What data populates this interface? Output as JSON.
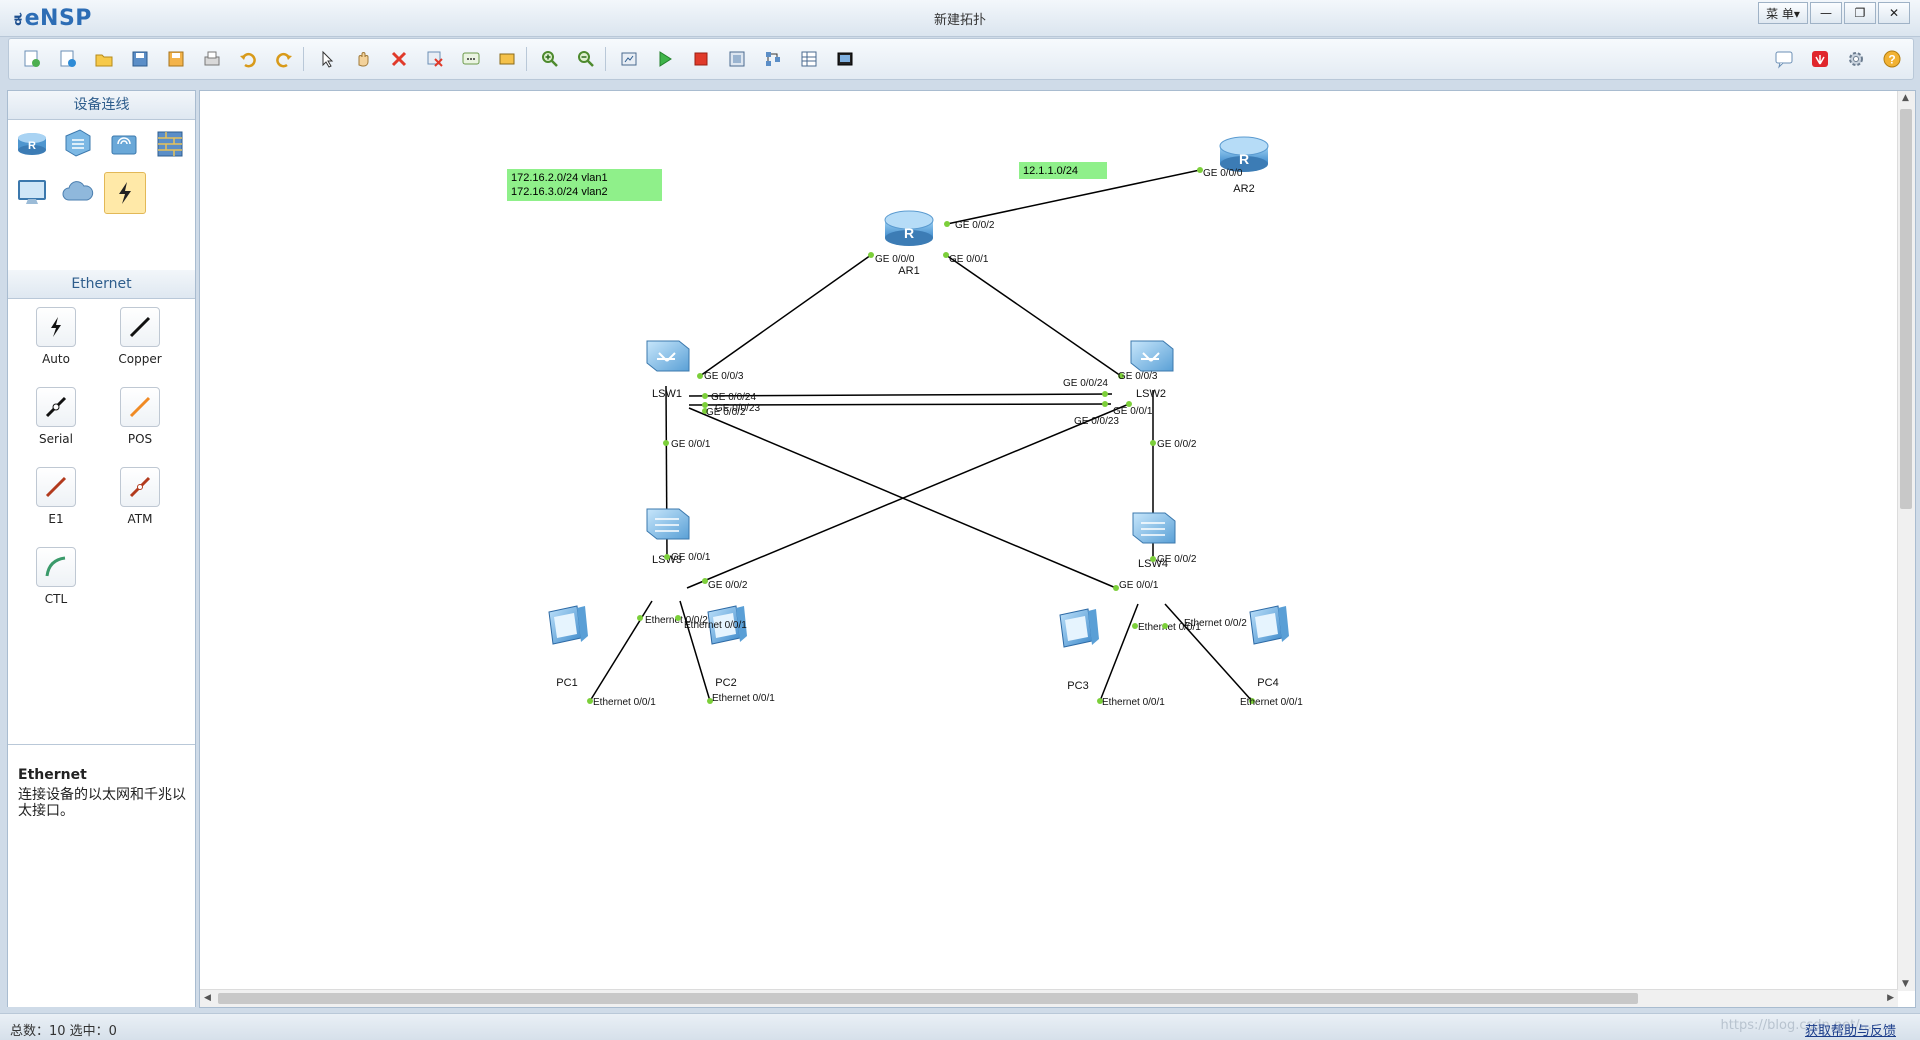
{
  "app": {
    "name": "eNSP",
    "window_title": "新建拓扑"
  },
  "window_buttons": {
    "menu": "菜 单▾",
    "minimize": "—",
    "restore": "❐",
    "close": "✕"
  },
  "toolbar": {
    "items": [
      "new-topology",
      "new-example",
      "open",
      "save",
      "save-as",
      "print",
      "undo",
      "redo",
      "select",
      "pan",
      "delete",
      "delete-all-links",
      "add-text",
      "add-rectangle",
      "zoom-in",
      "zoom-out",
      "fit-view",
      "start-device",
      "stop-device",
      "capture",
      "topology-view",
      "grid",
      "screenshot"
    ],
    "right_items": [
      "forum",
      "huawei",
      "settings",
      "help"
    ]
  },
  "left_panel": {
    "devices_header": "设备连线",
    "device_icons": [
      "router-icon",
      "switch-icon",
      "wireless-icon",
      "firewall-icon",
      "pc-icon",
      "cloud-icon",
      "cable-icon"
    ],
    "cables_header": "Ethernet",
    "cables": [
      {
        "label": "Auto",
        "color": "#111111"
      },
      {
        "label": "Copper",
        "color": "#111111"
      },
      {
        "label": "Serial",
        "color": "#111111"
      },
      {
        "label": "POS",
        "color": "#f08a24"
      },
      {
        "label": "E1",
        "color": "#b23a1d"
      },
      {
        "label": "ATM",
        "color": "#b23a1d"
      },
      {
        "label": "CTL",
        "color": "#3a9a6a"
      }
    ],
    "desc_title": "Ethernet",
    "desc_text": "连接设备的以太网和千兆以太接口。"
  },
  "topology": {
    "notes": [
      {
        "id": "note1",
        "lines": [
          "172.16.2.0/24 vlan1",
          "172.16.3.0/24 vlan2"
        ]
      },
      {
        "id": "note2",
        "lines": [
          "12.1.1.0/24"
        ]
      }
    ],
    "nodes": [
      {
        "id": "AR1",
        "label": "AR1",
        "type": "router"
      },
      {
        "id": "AR2",
        "label": "AR2",
        "type": "router"
      },
      {
        "id": "LSW1",
        "label": "LSW1",
        "type": "l3switch"
      },
      {
        "id": "LSW2",
        "label": "LSW2",
        "type": "l3switch"
      },
      {
        "id": "LSW3",
        "label": "LSW3",
        "type": "l2switch"
      },
      {
        "id": "LSW4",
        "label": "LSW4",
        "type": "l2switch"
      },
      {
        "id": "PC1",
        "label": "PC1",
        "type": "pc"
      },
      {
        "id": "PC2",
        "label": "PC2",
        "type": "pc"
      },
      {
        "id": "PC3",
        "label": "PC3",
        "type": "pc"
      },
      {
        "id": "PC4",
        "label": "PC4",
        "type": "pc"
      }
    ],
    "links": [
      {
        "a": "AR1",
        "b": "AR2",
        "a_port": "GE 0/0/2",
        "b_port": "GE 0/0/0"
      },
      {
        "a": "AR1",
        "b": "LSW1",
        "a_port": "GE 0/0/0",
        "b_port": "GE 0/0/3"
      },
      {
        "a": "AR1",
        "b": "LSW2",
        "a_port": "GE 0/0/1",
        "b_port": "GE 0/0/3"
      },
      {
        "a": "LSW1",
        "b": "LSW2",
        "a_port": "GE 0/0/24",
        "b_port": "GE 0/0/24"
      },
      {
        "a": "LSW1",
        "b": "LSW2",
        "a_port": "GE 0/0/23",
        "b_port": "GE 0/0/23"
      },
      {
        "a": "LSW1",
        "b": "LSW3",
        "a_port": "GE 0/0/1",
        "b_port": "GE 0/0/1"
      },
      {
        "a": "LSW1",
        "b": "LSW4",
        "a_port": "GE 0/0/2",
        "b_port": "GE 0/0/1"
      },
      {
        "a": "LSW2",
        "b": "LSW3",
        "a_port": "GE 0/0/1",
        "b_port": "GE 0/0/2"
      },
      {
        "a": "LSW2",
        "b": "LSW4",
        "a_port": "GE 0/0/2",
        "b_port": "GE 0/0/2"
      },
      {
        "a": "LSW3",
        "b": "PC1",
        "a_port": "Ethernet 0/0/2",
        "b_port": "Ethernet 0/0/1"
      },
      {
        "a": "LSW3",
        "b": "PC2",
        "a_port": "Ethernet 0/0/1",
        "b_port": "Ethernet 0/0/1"
      },
      {
        "a": "LSW4",
        "b": "PC3",
        "a_port": "Ethernet 0/0/1",
        "b_port": "Ethernet 0/0/1"
      },
      {
        "a": "LSW4",
        "b": "PC4",
        "a_port": "Ethernet 0/0/2",
        "b_port": "Ethernet 0/0/1"
      }
    ],
    "link_color": "#000000",
    "port_dot_color": "#7ccf3a",
    "note_bg": "#8ff08a"
  },
  "statusbar": {
    "left": "总数：10  选中：0",
    "right": "获取帮助与反馈",
    "watermark": "https://blog.csdn.net/..."
  }
}
